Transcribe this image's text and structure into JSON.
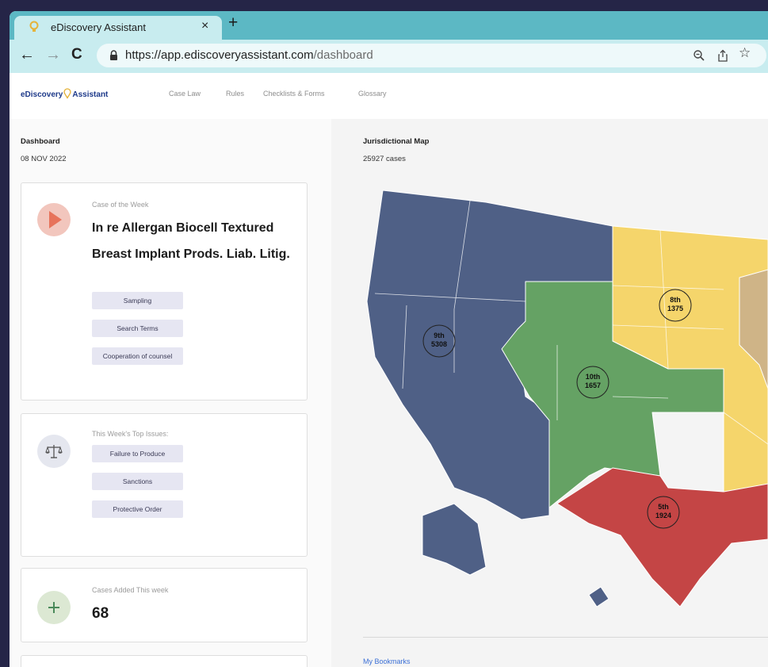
{
  "browser": {
    "tab_title": "eDiscovery Assistant",
    "tab_close": "×",
    "new_tab": "+",
    "url_host": "https://app.ediscoveryassistant.com",
    "url_path": "/dashboard",
    "icons": [
      "lightbulb-icon",
      "back-icon",
      "forward-icon",
      "reload-icon",
      "lock-icon",
      "zoom-icon",
      "share-icon",
      "star-icon"
    ]
  },
  "nav": {
    "logo_left": "eDiscovery",
    "logo_right": "Assistant",
    "links": [
      "Case Law",
      "Rules",
      "Checklists & Forms",
      "Glossary"
    ]
  },
  "dashboard": {
    "title": "Dashboard",
    "date": "08 NOV 2022"
  },
  "case_of_week": {
    "label": "Case of the Week",
    "title": "In re Allergan Biocell Textured Breast Implant Prods. Liab. Litig.",
    "tags": [
      "Sampling",
      "Search Terms",
      "Cooperation of counsel"
    ]
  },
  "top_issues": {
    "label": "This Week's Top Issues:",
    "items": [
      "Failure to Produce",
      "Sanctions",
      "Protective Order"
    ]
  },
  "cases_added": {
    "label": "Cases Added This week",
    "count": "68"
  },
  "map": {
    "title": "Jurisdictional Map",
    "total": "25927 cases",
    "circuits": [
      {
        "name": "9th",
        "count": "5308",
        "color": "#4f6086"
      },
      {
        "name": "10th",
        "count": "1657",
        "color": "#65a264"
      },
      {
        "name": "8th",
        "count": "1375",
        "color": "#f5d56b"
      },
      {
        "name": "5th",
        "count": "1924",
        "color": "#c44545"
      }
    ],
    "extra_color": "#cfb487"
  },
  "bookmarks": "My Bookmarks",
  "colors": {
    "accent": "#5cb8c4",
    "play": "#e7735b",
    "play_bg": "#f2c6bd",
    "plus_bg": "#dce8d3"
  }
}
